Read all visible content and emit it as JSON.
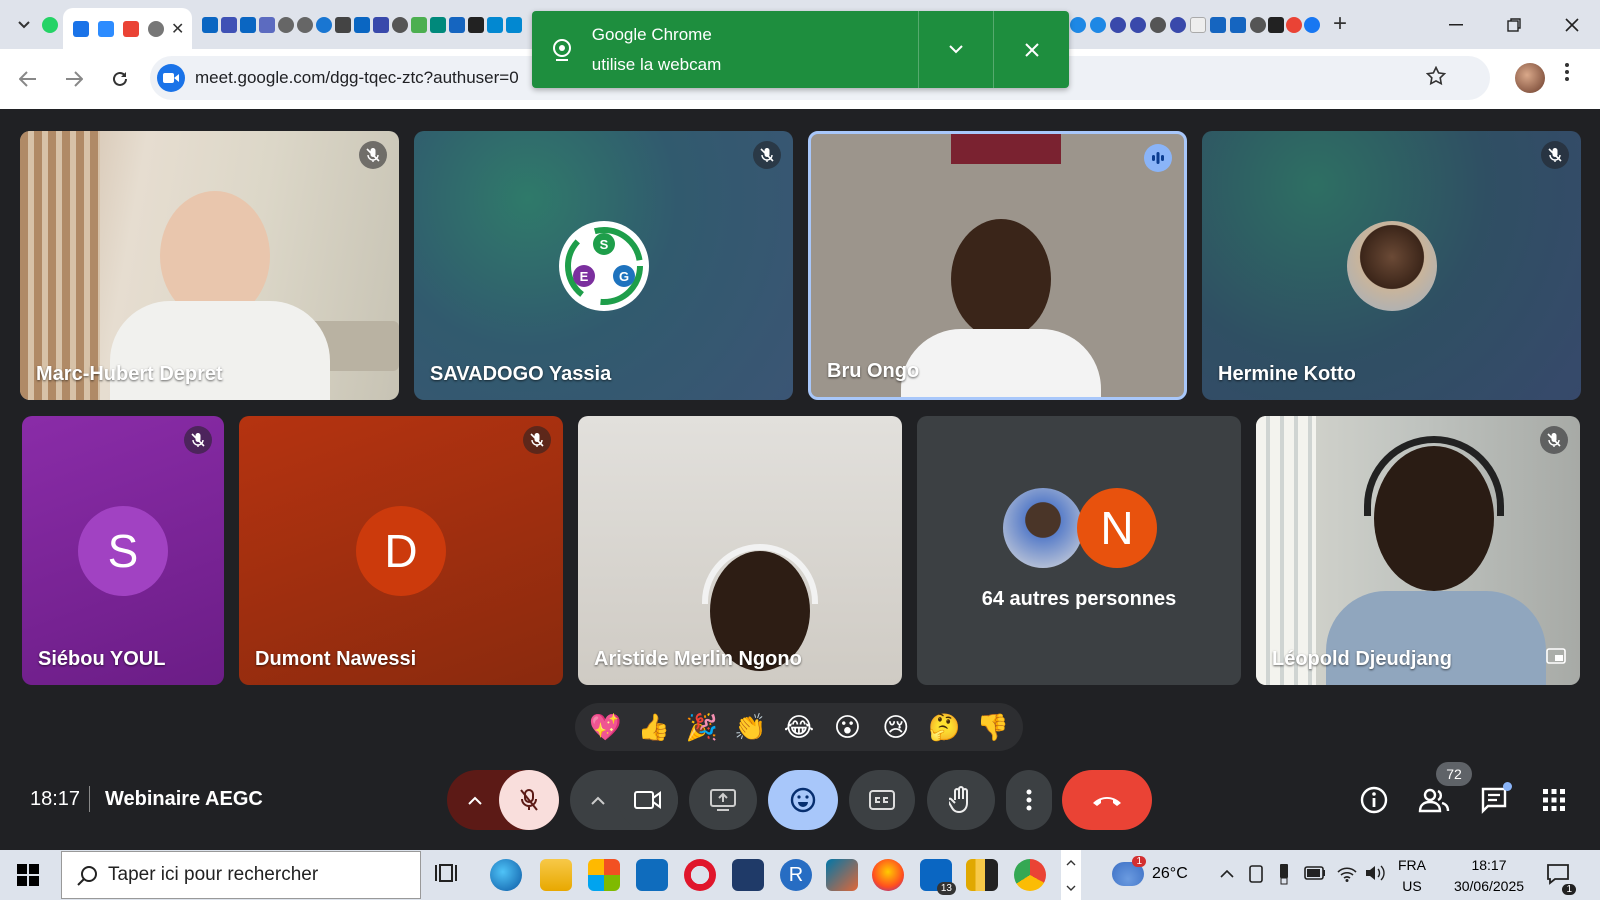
{
  "browser": {
    "url": "meet.google.com/dgg-tqec-ztc?authuser=0",
    "tab_close": "✕",
    "new_tab": "+"
  },
  "notification": {
    "line1": "Google Chrome",
    "line2": "utilise la webcam",
    "color": "#1e8e3e"
  },
  "participants": [
    {
      "name": "Marc-Hubert Depret",
      "status": "muted"
    },
    {
      "name": "SAVADOGO Yassia",
      "status": "muted"
    },
    {
      "name": "Bru Ongo",
      "status": "speaking"
    },
    {
      "name": "Hermine Kotto",
      "status": "muted"
    },
    {
      "name": "Siébou YOUL",
      "initial": "S",
      "status": "muted"
    },
    {
      "name": "Dumont Nawessi",
      "initial": "D",
      "status": "muted"
    },
    {
      "name": "Aristide Merlin Ngono",
      "status": "video"
    },
    {
      "name": "64 autres personnes",
      "initial": "N",
      "status": "group"
    },
    {
      "name": "Léopold Djeudjang",
      "status": "muted"
    }
  ],
  "logo_letters": {
    "s": "S",
    "e": "E",
    "g": "G"
  },
  "reactions": [
    "💖",
    "👍",
    "🎉",
    "👏",
    "😂",
    "😮",
    "😢",
    "🤔",
    "👎"
  ],
  "meeting": {
    "time": "18:17",
    "title": "Webinaire AEGC",
    "participant_count": "72",
    "end_call_color": "#ea4335"
  },
  "taskbar": {
    "search_placeholder": "Taper ici pour rechercher",
    "weather": "26°C",
    "weather_badge": "1",
    "language_top": "FRA",
    "language_bottom": "US",
    "time": "18:17",
    "date": "30/06/2025",
    "linkedin_badge": "13",
    "notif_badge": "1",
    "r_app": "R"
  }
}
